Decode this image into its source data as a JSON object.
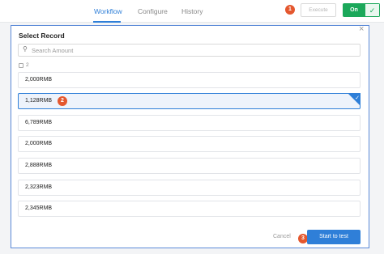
{
  "topbar": {
    "tabs": [
      {
        "label": "Workflow",
        "active": true
      },
      {
        "label": "Configure",
        "active": false
      },
      {
        "label": "History",
        "active": false
      }
    ],
    "execute_label": "Execute",
    "toggle_label": "On",
    "toggle_icon": "check-icon"
  },
  "markers": [
    "1",
    "2",
    "3"
  ],
  "modal": {
    "title": "Select Record",
    "search_placeholder": "Search Amount",
    "count": "2",
    "records": [
      {
        "label": "2,000RMB",
        "selected": false
      },
      {
        "label": "1,128RMB",
        "selected": true
      },
      {
        "label": "6,789RMB",
        "selected": false
      },
      {
        "label": "2,000RMB",
        "selected": false
      },
      {
        "label": "2,888RMB",
        "selected": false
      },
      {
        "label": "2,323RMB",
        "selected": false
      },
      {
        "label": "2,345RMB",
        "selected": false
      }
    ],
    "cancel_label": "Cancel",
    "start_label": "Start to test"
  },
  "colors": {
    "accent": "#2f7fd8",
    "on_green": "#1ba85a",
    "marker_red": "#e4572e"
  }
}
